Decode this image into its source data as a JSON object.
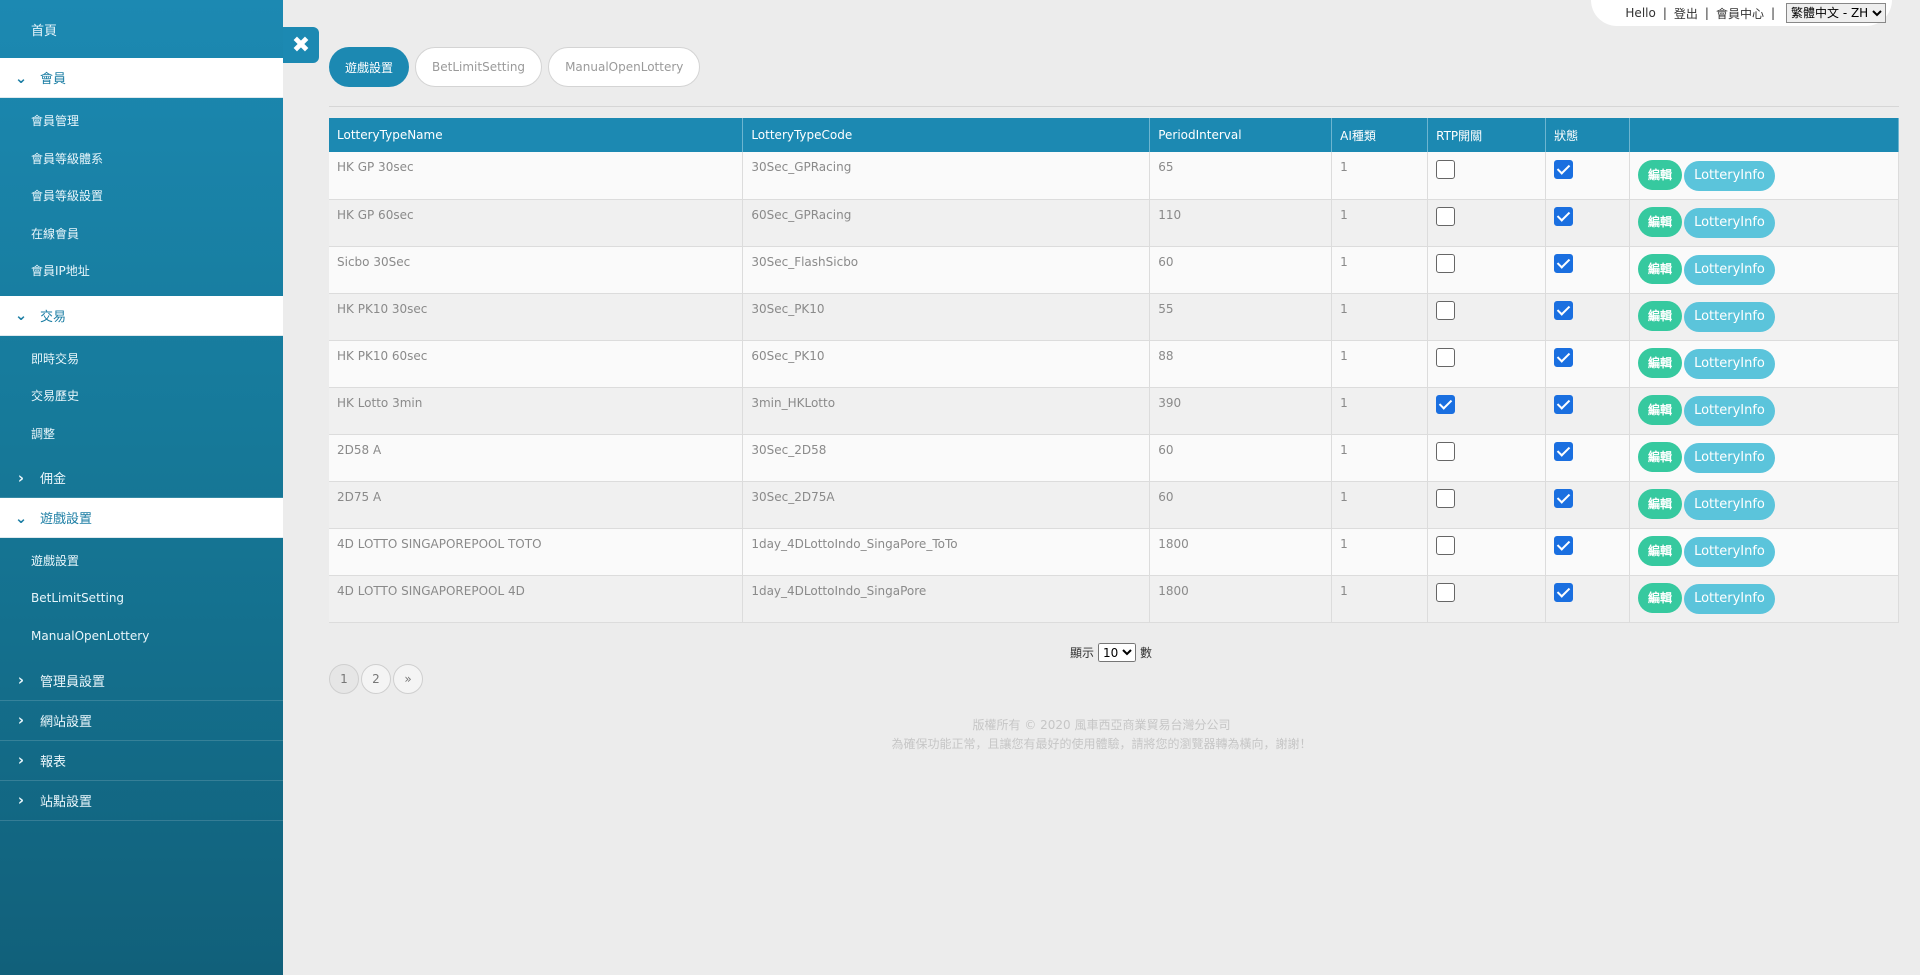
{
  "sidebar": {
    "home": "首頁",
    "groups": [
      {
        "label": "會員",
        "state": "open",
        "items": [
          "會員管理",
          "會員等級體系",
          "會員等級設置",
          "在線會員",
          "會員IP地址"
        ]
      },
      {
        "label": "交易",
        "state": "open",
        "items": [
          "即時交易",
          "交易歷史",
          "調整"
        ]
      },
      {
        "label": "佣金",
        "state": "collapsed",
        "items": []
      },
      {
        "label": "遊戲設置",
        "state": "open",
        "items": [
          "遊戲設置",
          "BetLimitSetting",
          "ManualOpenLottery"
        ]
      },
      {
        "label": "管理員設置",
        "state": "collapsed",
        "items": []
      },
      {
        "label": "網站設置",
        "state": "collapsed",
        "items": []
      },
      {
        "label": "報表",
        "state": "collapsed",
        "items": []
      },
      {
        "label": "站點設置",
        "state": "collapsed",
        "items": []
      }
    ]
  },
  "topbar": {
    "hello": "Hello",
    "logout": "登出",
    "member_center": "會員中心",
    "language_selected": "繁體中文 - ZH"
  },
  "tabs": [
    {
      "label": "遊戲設置",
      "active": true
    },
    {
      "label": "BetLimitSetting",
      "active": false
    },
    {
      "label": "ManualOpenLottery",
      "active": false
    }
  ],
  "table": {
    "columns": [
      "LotteryTypeName",
      "LotteryTypeCode",
      "PeriodInterval",
      "AI種類",
      "RTP開關",
      "狀態",
      ""
    ],
    "edit_label": "編輯",
    "info_label": "LotteryInfo",
    "rows": [
      {
        "name": "HK GP 30sec",
        "code": "30Sec_GPRacing",
        "period": "65",
        "ai": "1",
        "rtp": false,
        "status": true
      },
      {
        "name": "HK GP 60sec",
        "code": "60Sec_GPRacing",
        "period": "110",
        "ai": "1",
        "rtp": false,
        "status": true
      },
      {
        "name": "Sicbo 30Sec",
        "code": "30Sec_FlashSicbo",
        "period": "60",
        "ai": "1",
        "rtp": false,
        "status": true
      },
      {
        "name": "HK PK10 30sec",
        "code": "30Sec_PK10",
        "period": "55",
        "ai": "1",
        "rtp": false,
        "status": true
      },
      {
        "name": "HK PK10 60sec",
        "code": "60Sec_PK10",
        "period": "88",
        "ai": "1",
        "rtp": false,
        "status": true
      },
      {
        "name": "HK Lotto 3min",
        "code": "3min_HKLotto",
        "period": "390",
        "ai": "1",
        "rtp": true,
        "status": true
      },
      {
        "name": "2D58 A",
        "code": "30Sec_2D58",
        "period": "60",
        "ai": "1",
        "rtp": false,
        "status": true
      },
      {
        "name": "2D75 A",
        "code": "30Sec_2D75A",
        "period": "60",
        "ai": "1",
        "rtp": false,
        "status": true
      },
      {
        "name": "4D LOTTO SINGAPOREPOOL TOTO",
        "code": "1day_4DLottoIndo_SingaPore_ToTo",
        "period": "1800",
        "ai": "1",
        "rtp": false,
        "status": true
      },
      {
        "name": "4D LOTTO SINGAPOREPOOL 4D",
        "code": "1day_4DLottoIndo_SingaPore",
        "period": "1800",
        "ai": "1",
        "rtp": false,
        "status": true
      }
    ]
  },
  "page_size": {
    "prefix": "顯示",
    "value": "10",
    "suffix": "數"
  },
  "pagination": [
    "1",
    "2",
    "»"
  ],
  "footer": {
    "line1": "版權所有 © 2020 風車西亞商業貿易台灣分公司",
    "line2": "為確保功能正常，且讓您有最好的使用體驗，請將您的瀏覽器轉為橫向，謝謝！"
  },
  "icons": {
    "close": "close-icon",
    "chevron_down": "chevron-down-icon",
    "chevron_right": "chevron-right-icon"
  },
  "colors": {
    "primary": "#1c89b2",
    "edit_button": "#36c99f",
    "info_button": "#5bc4db",
    "checkbox_on": "#1a6fe0"
  }
}
